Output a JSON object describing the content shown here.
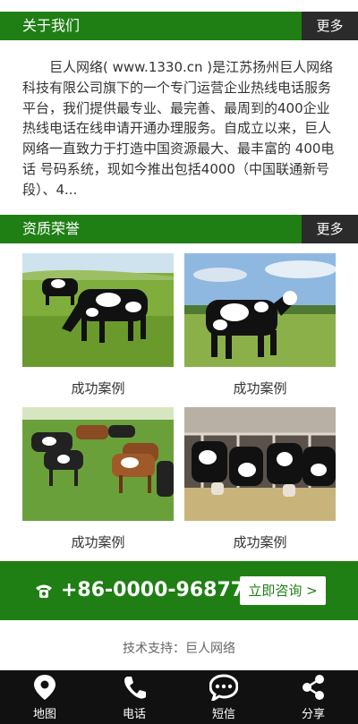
{
  "about": {
    "title": "关于我们",
    "more": "更多",
    "text": "巨人网络( www.1330.cn )是江苏扬州巨人网络科技有限公司旗下的一个专门运营企业热线电话服务平台，我们提供最专业、最完善、最周到的400企业热线电话在线申请开通办理服务。自成立以来，巨人网络一直致力于打造中国资源最大、最丰富的 400电话 号码系统，现如今推出包括4000（中国联通新号段）、4..."
  },
  "honors": {
    "title": "资质荣誉",
    "more": "更多",
    "items": [
      {
        "caption": "成功案例"
      },
      {
        "caption": "成功案例"
      },
      {
        "caption": "成功案例"
      },
      {
        "caption": "成功案例"
      }
    ]
  },
  "cta": {
    "phone": "+86-0000-96877",
    "button": "立即咨询 >"
  },
  "footer": {
    "support": "技术支持：巨人网络"
  },
  "nav": {
    "items": [
      {
        "label": "地图",
        "icon": "map-pin-icon"
      },
      {
        "label": "电话",
        "icon": "phone-icon"
      },
      {
        "label": "短信",
        "icon": "chat-icon"
      },
      {
        "label": "分享",
        "icon": "share-icon"
      }
    ]
  },
  "colors": {
    "brand": "#1f7f14",
    "dark": "#2b2b2b",
    "nav": "#111111"
  }
}
